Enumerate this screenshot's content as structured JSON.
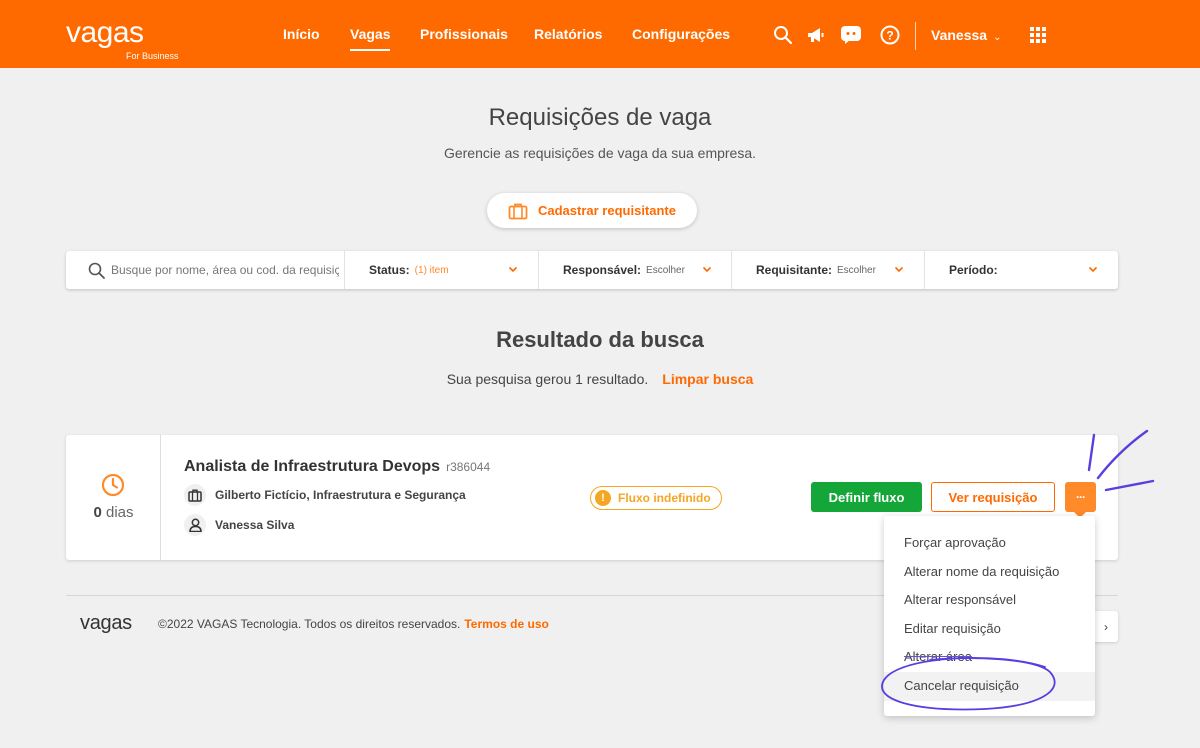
{
  "header": {
    "logo_main": "vagas",
    "logo_sub": "For Business",
    "nav": [
      {
        "label": "Início"
      },
      {
        "label": "Vagas"
      },
      {
        "label": "Profissionais"
      },
      {
        "label": "Relatórios"
      },
      {
        "label": "Configurações"
      }
    ],
    "active_nav": "Vagas",
    "icons": [
      "search-icon",
      "megaphone-icon",
      "chat-icon",
      "help-icon",
      "apps-grid-icon"
    ],
    "user_name": "Vanessa",
    "brand_color": "#ff6a00"
  },
  "page": {
    "title": "Requisições de vaga",
    "subtitle": "Gerencie as requisições de vaga da sua empresa.",
    "add_button_label": "Cadastrar requisitante"
  },
  "filters": {
    "search_placeholder": "Busque por nome, área ou cod. da requisição",
    "status": {
      "label": "Status:",
      "value": "(1) item"
    },
    "responsavel": {
      "label": "Responsável:",
      "value": "Escolher"
    },
    "requisitante": {
      "label": "Requisitante:",
      "value": "Escolher"
    },
    "periodo": {
      "label": "Período:",
      "value": ""
    }
  },
  "results": {
    "title": "Resultado da busca",
    "summary": "Sua pesquisa gerou 1 resultado.",
    "clear_label": "Limpar busca"
  },
  "card": {
    "days_number": "0",
    "days_label": "dias",
    "job_title": "Analista de Infraestrutura Devops",
    "job_code": "r386044",
    "requester_area": "Gilberto Fictício, Infraestrutura e Segurança",
    "responsible": "Vanessa Silva",
    "status_badge": "Fluxo indefinido",
    "define_flow_label": "Definir fluxo",
    "view_label": "Ver requisição",
    "more_label": "···",
    "success_color": "#15a63a",
    "warning_color": "#f5a623"
  },
  "dropdown": {
    "items": [
      {
        "label": "Forçar aprovação"
      },
      {
        "label": "Alterar nome da requisição"
      },
      {
        "label": "Alterar responsável"
      },
      {
        "label": "Editar requisição"
      },
      {
        "label": "Alterar área"
      },
      {
        "label": "Cancelar requisição"
      }
    ]
  },
  "footer": {
    "logo": "vagas",
    "copyright": "©2022 VAGAS Tecnologia. Todos os direitos reservados.",
    "terms_label": "Termos de uso",
    "arrow": "›"
  }
}
